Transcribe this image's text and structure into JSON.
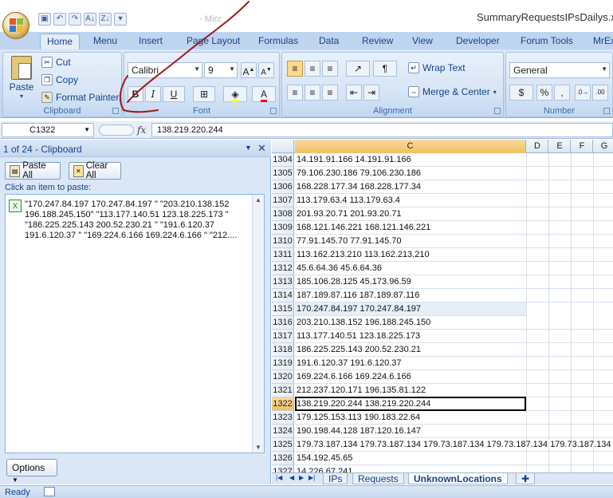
{
  "window": {
    "title": "SummaryRequestsIPsDailys.xlsm",
    "blurred_title": "- Micr"
  },
  "tabs": [
    "Home",
    "Menu",
    "Insert",
    "Page Layout",
    "Formulas",
    "Data",
    "Review",
    "View",
    "Developer",
    "Forum Tools",
    "MrEx"
  ],
  "ribbon": {
    "clipboard": {
      "paste": "Paste",
      "cut": "Cut",
      "copy": "Copy",
      "format_painter": "Format Painter",
      "label": "Clipboard"
    },
    "font": {
      "name": "Calibri",
      "size": "9",
      "label": "Font",
      "bold": "B",
      "italic": "I",
      "underline": "U"
    },
    "alignment": {
      "wrap_text": "Wrap Text",
      "merge_center": "Merge & Center",
      "label": "Alignment"
    },
    "number": {
      "format": "General",
      "currency": "$",
      "percent": "%",
      "comma": ",",
      "label": "Number"
    }
  },
  "formula_bar": {
    "name_box": "C1322",
    "fx": "fx",
    "value": "138.219.220.244"
  },
  "clipboard_pane": {
    "title": "1 of 24 - Clipboard",
    "paste_all": "Paste All",
    "clear_all": "Clear All",
    "hint": "Click an item to paste:",
    "items": [
      "\"170.247.84.197 170.247.84.197 \" \"203.210.138.152 196.188.245.150\" \"113.177.140.51 123.18.225.173 \" \"186.225.225.143 200.52.230.21 \" \"191.6.120.37 191.6.120.37 \" \"169.224.6.166 169.224.6.166 \" \"212...."
    ],
    "options": "Options"
  },
  "grid": {
    "columns": [
      "C",
      "D",
      "E",
      "F",
      "G"
    ],
    "selected_row": "1322",
    "highlight_row": "1315",
    "rows": [
      {
        "num": "1304",
        "c": "14.191.91.166 14.191.91.166"
      },
      {
        "num": "1305",
        "c": "79.106.230.186 79.106.230.186"
      },
      {
        "num": "1306",
        "c": "168.228.177.34 168.228.177.34"
      },
      {
        "num": "1307",
        "c": "113.179.63.4 113.179.63.4"
      },
      {
        "num": "1308",
        "c": "201.93.20.71 201.93.20.71"
      },
      {
        "num": "1309",
        "c": "168.121.146.221 168.121.146.221"
      },
      {
        "num": "1310",
        "c": "77.91.145.70 77.91.145.70"
      },
      {
        "num": "1311",
        "c": "113.162.213.210 113.162.213.210"
      },
      {
        "num": "1312",
        "c": "45.6.64.36 45.6.64.36"
      },
      {
        "num": "1313",
        "c": "185.106.28.125 45.173.96.59"
      },
      {
        "num": "1314",
        "c": "187.189.87.116 187.189.87.116"
      },
      {
        "num": "1315",
        "c": "170.247.84.197 170.247.84.197"
      },
      {
        "num": "1316",
        "c": "203.210.138.152 196.188.245.150"
      },
      {
        "num": "1317",
        "c": "113.177.140.51 123.18.225.173"
      },
      {
        "num": "1318",
        "c": "186.225.225.143 200.52.230.21"
      },
      {
        "num": "1319",
        "c": "191.6.120.37 191.6.120.37"
      },
      {
        "num": "1320",
        "c": "169.224.6.166 169.224.6.166"
      },
      {
        "num": "1321",
        "c": "212.237.120.171 196.135.81.122"
      },
      {
        "num": "1322",
        "c": "138.219.220.244 138.219.220.244"
      },
      {
        "num": "1323",
        "c": "179.125.153.113 190.183.22.64"
      },
      {
        "num": "1324",
        "c": "190.198.44.128 187.120.16.147"
      },
      {
        "num": "1325",
        "c": "179.73.187.134 179.73.187.134 179.73.187.134 179.73.187.134 179.73.187.134"
      },
      {
        "num": "1326",
        "c": "154.192.45.65"
      },
      {
        "num": "1327",
        "c": "14.226.67.241"
      }
    ]
  },
  "sheets": [
    "IPs",
    "Requests",
    "UnknownLocations"
  ],
  "status": {
    "text": "Ready"
  },
  "colors": {
    "ribbon": "#c7d9f0",
    "accent": "#15428b",
    "annotation": "#9b1b1b",
    "selected_header": "#f1c15f"
  }
}
